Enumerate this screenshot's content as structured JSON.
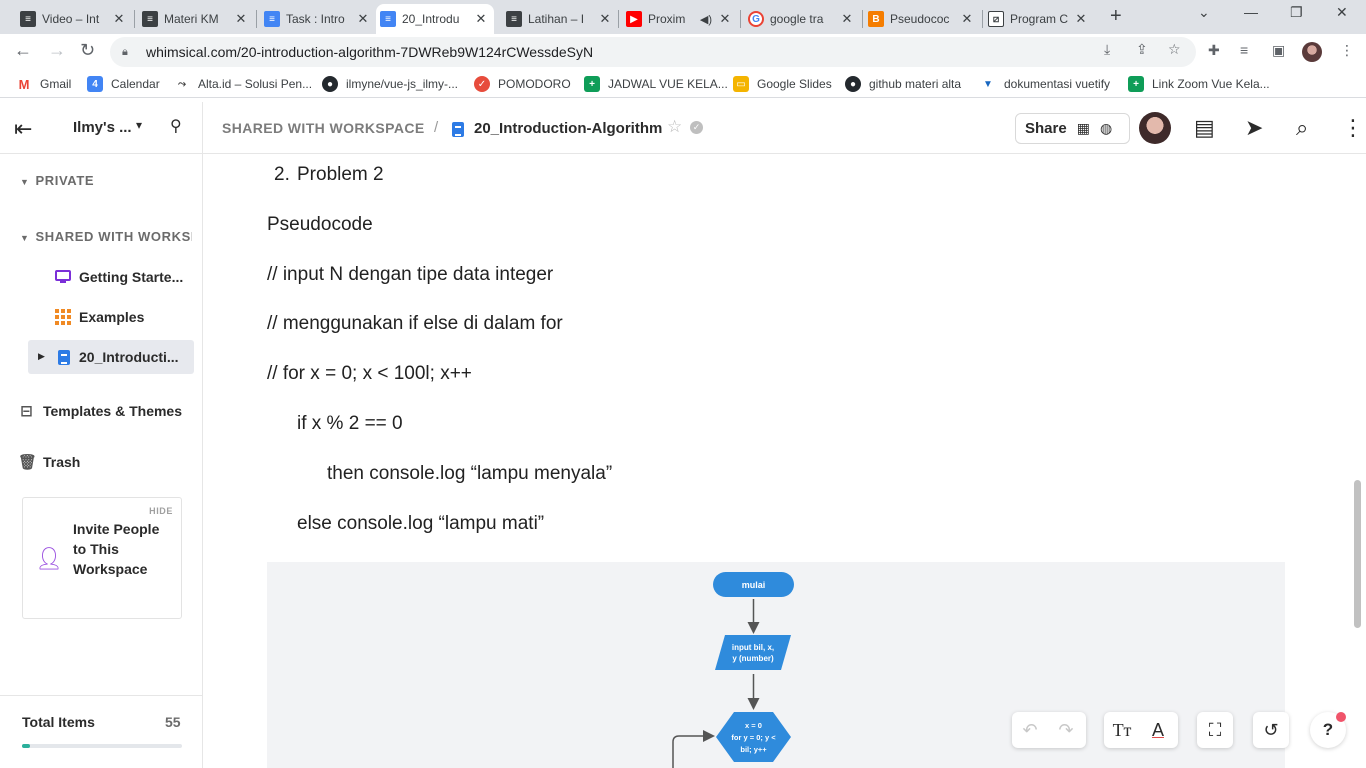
{
  "browser": {
    "tabs": [
      {
        "title": "Video – Int",
        "favicon": "whimsical-icon",
        "color": "#3c4043"
      },
      {
        "title": "Materi KM",
        "favicon": "whimsical-icon",
        "color": "#3c4043"
      },
      {
        "title": "Task : Intro",
        "favicon": "google-docs-icon",
        "color": "#4285f4"
      },
      {
        "title": "20_Introdu",
        "favicon": "google-docs-icon",
        "color": "#4285f4",
        "active": true
      },
      {
        "title": "Latihan – I",
        "favicon": "whimsical-icon",
        "color": "#3c4043"
      },
      {
        "title": "Proxim",
        "favicon": "youtube-icon",
        "color": "#ff0000"
      },
      {
        "title": "google tra",
        "favicon": "google-icon",
        "color": "#4285f4"
      },
      {
        "title": "Pseudococ",
        "favicon": "blogger-icon",
        "color": "#f57d00"
      },
      {
        "title": "Program C",
        "favicon": "whimsical-icon",
        "color": "#3c4043"
      }
    ],
    "url": "whimsical.com/20-introduction-algorithm-7DWReb9W124rCWessdeSyN",
    "bookmarks": [
      {
        "label": "Gmail",
        "favicon": "gmail-icon",
        "color": "#ea4335"
      },
      {
        "label": "Calendar",
        "favicon": "calendar-icon",
        "color": "#4285f4"
      },
      {
        "label": "Alta.id – Solusi Pen...",
        "favicon": "alta-icon",
        "color": "#444444"
      },
      {
        "label": "ilmyne/vue-js_ilmy-...",
        "favicon": "github-icon",
        "color": "#24292e"
      },
      {
        "label": "POMODORO",
        "favicon": "pomodoro-icon",
        "color": "#e74c3c"
      },
      {
        "label": "JADWAL VUE KELA...",
        "favicon": "sheets-icon",
        "color": "#0f9d58"
      },
      {
        "label": "Google Slides",
        "favicon": "slides-icon",
        "color": "#f4b400"
      },
      {
        "label": "github materi alta",
        "favicon": "github-icon",
        "color": "#24292e"
      },
      {
        "label": "dokumentasi vuetify",
        "favicon": "vuetify-icon",
        "color": "#1867c0"
      },
      {
        "label": "Link Zoom Vue Kela...",
        "favicon": "sheets-icon",
        "color": "#0f9d58"
      }
    ]
  },
  "header": {
    "workspace_name": "Ilmy's ...",
    "breadcrumb_shared": "SHARED WITH WORKSPACE",
    "breadcrumb_sep": "/",
    "doc_title": "20_Introduction-Algorithm",
    "share_label": "Share"
  },
  "sidebar": {
    "private_label": "PRIVATE",
    "shared_label": "SHARED WITH WORKSPACE",
    "items": [
      {
        "label": "Getting Starte...",
        "icon": "monitor-icon"
      },
      {
        "label": "Examples",
        "icon": "grid-icon"
      },
      {
        "label": "20_Introducti...",
        "icon": "doc-icon",
        "selected": true
      }
    ],
    "templates_label": "Templates & Themes",
    "trash_label": "Trash",
    "invite_hide": "HIDE",
    "invite_text": "Invite People to This Workspace",
    "total_label": "Total Items",
    "total_value": "55",
    "total_progress": 0.05
  },
  "document": {
    "list_number": "2.",
    "list_item": "Problem 2",
    "heading": "Pseudocode",
    "lines": [
      "// input N dengan tipe data integer",
      "// menggunakan if else di dalam for",
      "// for x = 0; x < 100l; x++",
      "if x % 2 == 0",
      "then console.log “lampu menyala”",
      "else console.log “lampu mati”"
    ]
  },
  "flowchart": {
    "start_label": "mulai",
    "input_label": "input bil, x, y (number)",
    "loop_label": "x = 0 for y = 0; y < bil; y++",
    "colors": {
      "node": "#2f8bdc",
      "arrow": "#555555",
      "bg": "#f2f3f5"
    }
  },
  "toolbar": {
    "help_label": "?"
  }
}
